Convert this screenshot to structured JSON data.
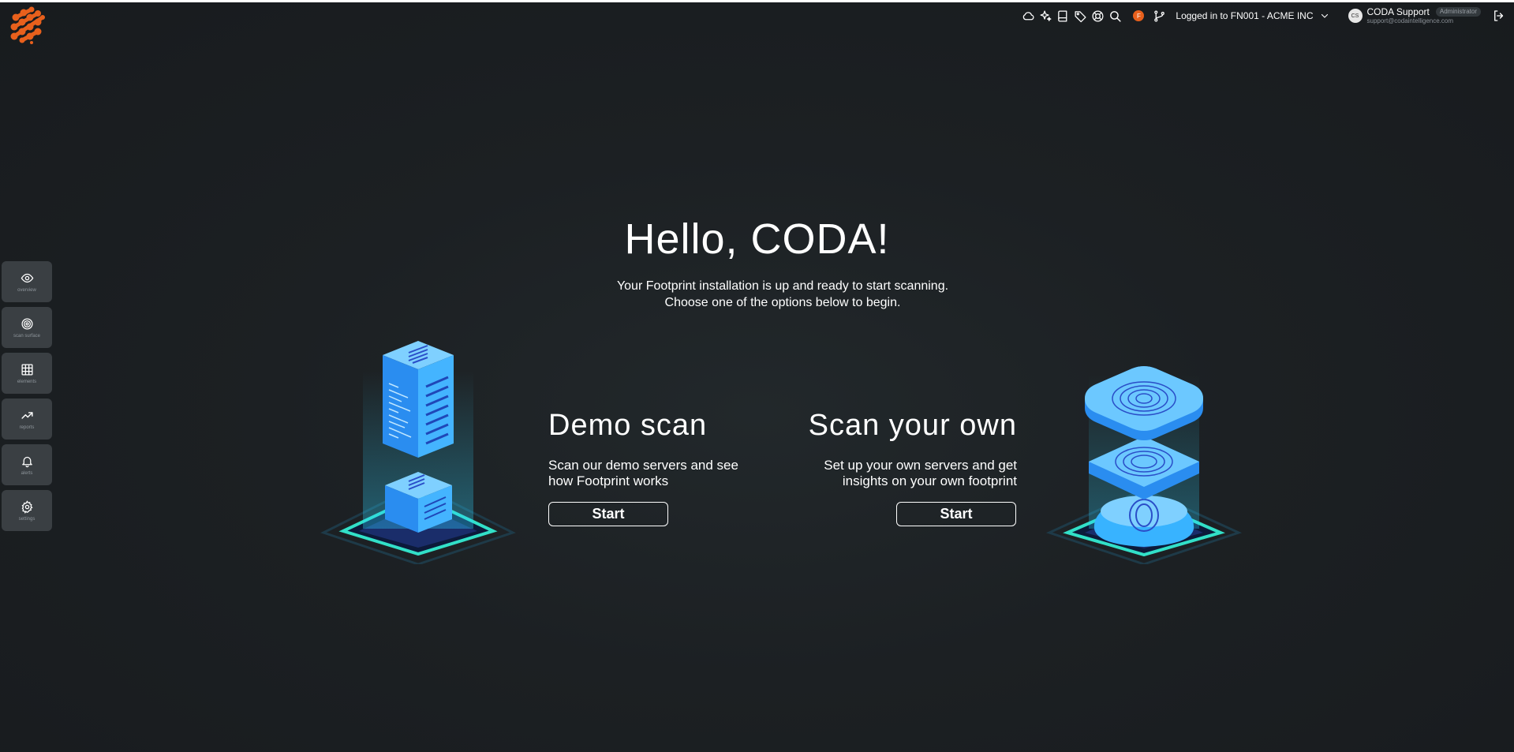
{
  "app": {
    "logo_icon": "coda-footprint-logo-icon",
    "accent_color": "#e8601c"
  },
  "header": {
    "icons": [
      "cloud-icon",
      "sparkles-icon",
      "book-icon",
      "tag-icon",
      "lifebuoy-icon",
      "search-icon"
    ],
    "notification_badge": "F",
    "branch_icon": "git-branch-icon",
    "tenant_label": "Logged in to FN001 - ACME INC",
    "user": {
      "initials": "CS",
      "name": "CODA Support",
      "role": "Administrator",
      "email": "support@codaintelligence.com"
    },
    "logout_icon": "logout-icon"
  },
  "sidebar": {
    "items": [
      {
        "label": "overview",
        "icon": "eye-icon"
      },
      {
        "label": "scan surface",
        "icon": "target-icon"
      },
      {
        "label": "elements",
        "icon": "grid-icon"
      },
      {
        "label": "reports",
        "icon": "trend-up-icon"
      },
      {
        "label": "alerts",
        "icon": "bell-icon"
      },
      {
        "label": "settings",
        "icon": "gear-icon"
      }
    ]
  },
  "main": {
    "greeting": "Hello, CODA!",
    "subtitle": "Your Footprint installation is up and ready to start scanning. Choose one of the options below to begin.",
    "demo": {
      "title": "Demo scan",
      "description": "Scan our demo servers and see how Footprint works",
      "button": "Start",
      "illustration": "server-illustration"
    },
    "own": {
      "title": "Scan your own",
      "description": "Set up your own servers and get insights on your own footprint",
      "button": "Start",
      "illustration": "fingerprint-illustration"
    }
  }
}
